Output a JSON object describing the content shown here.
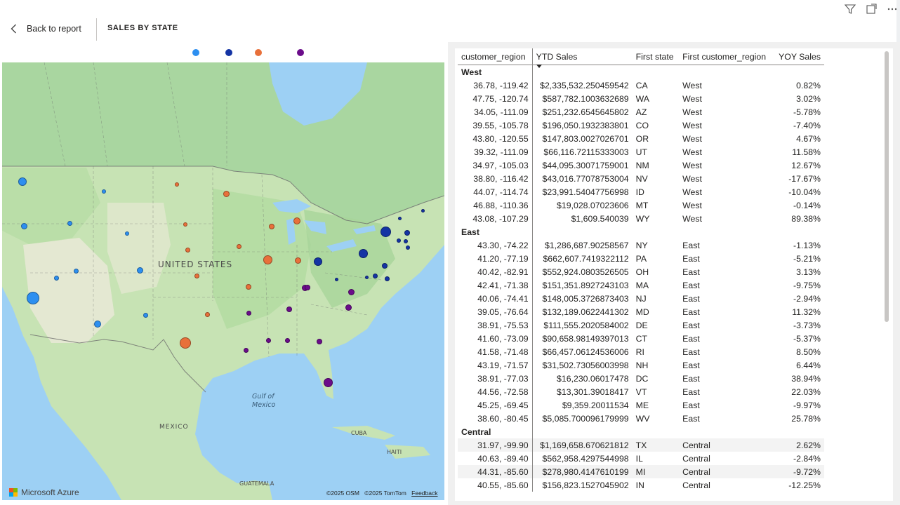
{
  "header": {
    "back_label": "Back to report",
    "page_title": "SALES BY STATE"
  },
  "legend": {
    "colors": [
      "#2d8ff0",
      "#1434a4",
      "#e8703a",
      "#6b0c8a"
    ]
  },
  "map": {
    "country_label": "UNITED STATES",
    "gulf_label_1": "Gulf of",
    "gulf_label_2": "Mexico",
    "mexico_label": "MEXICO",
    "cuba_label": "CUBA",
    "haiti_label": "HAITI",
    "guatemala_label": "GUATEMALA",
    "brand": "Microsoft Azure",
    "attribution": [
      "©2025 OSM",
      "©2025 TomTom"
    ],
    "feedback": "Feedback",
    "bubbles": [
      {
        "id": "CA",
        "color": "#2d8ff0",
        "size": 18
      },
      {
        "id": "WA",
        "color": "#2d8ff0",
        "size": 12
      },
      {
        "id": "AZ",
        "color": "#2d8ff0",
        "size": 10
      },
      {
        "id": "CO",
        "color": "#2d8ff0",
        "size": 9
      },
      {
        "id": "OR",
        "color": "#2d8ff0",
        "size": 9
      },
      {
        "id": "UT",
        "color": "#2d8ff0",
        "size": 7
      },
      {
        "id": "NM",
        "color": "#2d8ff0",
        "size": 7
      },
      {
        "id": "NV",
        "color": "#2d8ff0",
        "size": 7
      },
      {
        "id": "ID",
        "color": "#2d8ff0",
        "size": 7
      },
      {
        "id": "MT",
        "color": "#2d8ff0",
        "size": 6
      },
      {
        "id": "WY",
        "color": "#2d8ff0",
        "size": 6
      },
      {
        "id": "NY",
        "color": "#1434a4",
        "size": 15
      },
      {
        "id": "PA",
        "color": "#1434a4",
        "size": 13
      },
      {
        "id": "OH",
        "color": "#1434a4",
        "size": 12
      },
      {
        "id": "MA",
        "color": "#1434a4",
        "size": 8
      },
      {
        "id": "NJ",
        "color": "#1434a4",
        "size": 8
      },
      {
        "id": "MD",
        "color": "#1434a4",
        "size": 7
      },
      {
        "id": "DE",
        "color": "#1434a4",
        "size": 7
      },
      {
        "id": "CT",
        "color": "#1434a4",
        "size": 6
      },
      {
        "id": "RI",
        "color": "#1434a4",
        "size": 6
      },
      {
        "id": "NH",
        "color": "#1434a4",
        "size": 6
      },
      {
        "id": "DC",
        "color": "#1434a4",
        "size": 5
      },
      {
        "id": "VT",
        "color": "#1434a4",
        "size": 5
      },
      {
        "id": "ME",
        "color": "#1434a4",
        "size": 5
      },
      {
        "id": "WV",
        "color": "#1434a4",
        "size": 5
      },
      {
        "id": "TX",
        "color": "#e8703a",
        "size": 16
      },
      {
        "id": "IL",
        "color": "#e8703a",
        "size": 13
      },
      {
        "id": "MI",
        "color": "#e8703a",
        "size": 10
      },
      {
        "id": "IN",
        "color": "#e8703a",
        "size": 9
      },
      {
        "id": "MN",
        "color": "#e8703a",
        "size": 9
      },
      {
        "id": "WI",
        "color": "#e8703a",
        "size": 8
      },
      {
        "id": "MO",
        "color": "#e8703a",
        "size": 8
      },
      {
        "id": "IA",
        "color": "#e8703a",
        "size": 7
      },
      {
        "id": "KS",
        "color": "#e8703a",
        "size": 7
      },
      {
        "id": "OK",
        "color": "#e8703a",
        "size": 7
      },
      {
        "id": "NE",
        "color": "#e8703a",
        "size": 7
      },
      {
        "id": "SD",
        "color": "#e8703a",
        "size": 6
      },
      {
        "id": "ND",
        "color": "#e8703a",
        "size": 6
      },
      {
        "id": "FL",
        "color": "#6b0c8a",
        "size": 13
      },
      {
        "id": "GA",
        "color": "#6b0c8a",
        "size": 9
      },
      {
        "id": "NC",
        "color": "#6b0c8a",
        "size": 9
      },
      {
        "id": "VA",
        "color": "#6b0c8a",
        "size": 9
      },
      {
        "id": "TN",
        "color": "#6b0c8a",
        "size": 8
      },
      {
        "id": "KY",
        "color": "#6b0c8a",
        "size": 8
      },
      {
        "id": "SC",
        "color": "#6b0c8a",
        "size": 8
      },
      {
        "id": "AL",
        "color": "#6b0c8a",
        "size": 7
      },
      {
        "id": "LA",
        "color": "#6b0c8a",
        "size": 7
      },
      {
        "id": "AR",
        "color": "#6b0c8a",
        "size": 7
      },
      {
        "id": "MS",
        "color": "#6b0c8a",
        "size": 7
      }
    ]
  },
  "table": {
    "columns": [
      "customer_region",
      "YTD Sales",
      "First state",
      "First customer_region",
      "YOY Sales"
    ],
    "groups": [
      {
        "name": "West",
        "rows": [
          [
            "36.78, -119.42",
            "$2,335,532.250459542",
            "CA",
            "West",
            "0.82%"
          ],
          [
            "47.75, -120.74",
            "$587,782.1003632689",
            "WA",
            "West",
            "3.02%"
          ],
          [
            "34.05, -111.09",
            "$251,232.6545645802",
            "AZ",
            "West",
            "-5.78%"
          ],
          [
            "39.55, -105.78",
            "$196,050.1932383801",
            "CO",
            "West",
            "-7.40%"
          ],
          [
            "43.80, -120.55",
            "$147,803.0027026701",
            "OR",
            "West",
            "4.67%"
          ],
          [
            "39.32, -111.09",
            "$66,116.72115333003",
            "UT",
            "West",
            "11.58%"
          ],
          [
            "34.97, -105.03",
            "$44,095.30071759001",
            "NM",
            "West",
            "12.67%"
          ],
          [
            "38.80, -116.42",
            "$43,016.77078753004",
            "NV",
            "West",
            "-17.67%"
          ],
          [
            "44.07, -114.74",
            "$23,991.54047756998",
            "ID",
            "West",
            "-10.04%"
          ],
          [
            "46.88, -110.36",
            "$19,028.07023606",
            "MT",
            "West",
            "-0.14%"
          ],
          [
            "43.08, -107.29",
            "$1,609.540039",
            "WY",
            "West",
            "89.38%"
          ]
        ]
      },
      {
        "name": "East",
        "rows": [
          [
            "43.30, -74.22",
            "$1,286,687.90258567",
            "NY",
            "East",
            "-1.13%"
          ],
          [
            "41.20, -77.19",
            "$662,607.7419322112",
            "PA",
            "East",
            "-5.21%"
          ],
          [
            "40.42, -82.91",
            "$552,924.0803526505",
            "OH",
            "East",
            "3.13%"
          ],
          [
            "42.41, -71.38",
            "$151,351.8927243103",
            "MA",
            "East",
            "-9.75%"
          ],
          [
            "40.06, -74.41",
            "$148,005.3726873403",
            "NJ",
            "East",
            "-2.94%"
          ],
          [
            "39.05, -76.64",
            "$132,189.0622441302",
            "MD",
            "East",
            "11.32%"
          ],
          [
            "38.91, -75.53",
            "$111,555.2020584002",
            "DE",
            "East",
            "-3.73%"
          ],
          [
            "41.60, -73.09",
            "$90,658.98149397013",
            "CT",
            "East",
            "-5.37%"
          ],
          [
            "41.58, -71.48",
            "$66,457.06124536006",
            "RI",
            "East",
            "8.50%"
          ],
          [
            "43.19, -71.57",
            "$31,502.73056003998",
            "NH",
            "East",
            "6.44%"
          ],
          [
            "38.91, -77.03",
            "$16,230.06017478",
            "DC",
            "East",
            "38.94%"
          ],
          [
            "44.56, -72.58",
            "$13,301.39018417",
            "VT",
            "East",
            "22.03%"
          ],
          [
            "45.25, -69.45",
            "$9,359.20011534",
            "ME",
            "East",
            "-9.97%"
          ],
          [
            "38.60, -80.45",
            "$5,085.700096179999",
            "WV",
            "East",
            "25.78%"
          ]
        ]
      },
      {
        "name": "Central",
        "rows": [
          [
            "31.97, -99.90",
            "$1,169,658.670621812",
            "TX",
            "Central",
            "2.62%"
          ],
          [
            "40.63, -89.40",
            "$562,958.4297544998",
            "IL",
            "Central",
            "-2.84%"
          ],
          [
            "44.31, -85.60",
            "$278,980.4147610199",
            "MI",
            "Central",
            "-9.72%"
          ],
          [
            "40.55, -85.60",
            "$156,823.1527045902",
            "IN",
            "Central",
            "-12.25%"
          ]
        ]
      }
    ]
  }
}
